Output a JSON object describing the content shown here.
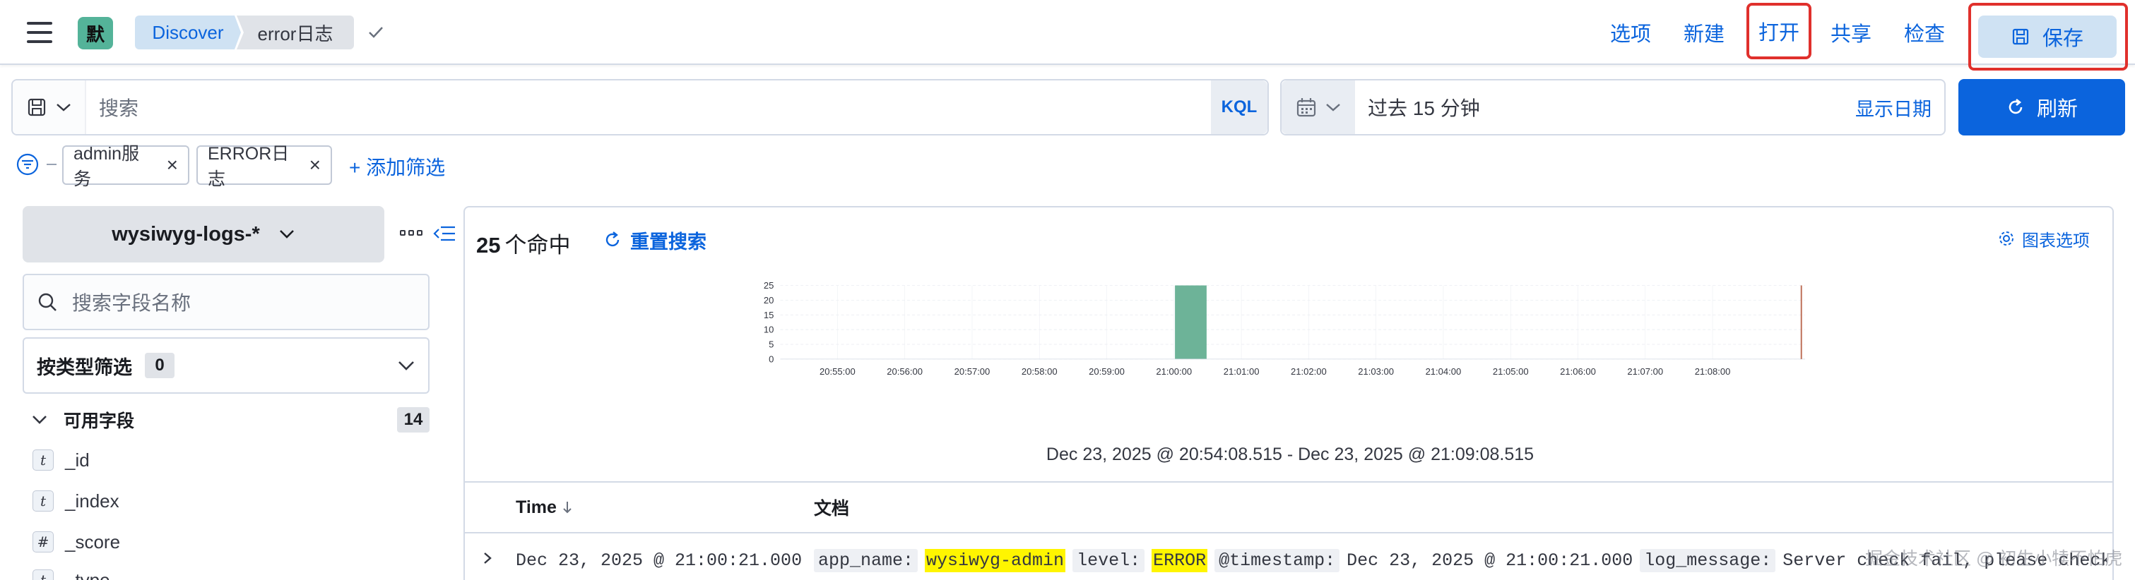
{
  "header": {
    "space_initial": "默",
    "breadcrumbs": [
      "Discover",
      "error日志"
    ],
    "nav": {
      "options": "选项",
      "new": "新建",
      "open": "打开",
      "share": "共享",
      "inspect": "检查",
      "save": "保存"
    },
    "highlight_color": "#e0302c",
    "accent_color": "#0b64dd"
  },
  "query": {
    "placeholder": "搜索",
    "language": "KQL",
    "time_range": "过去 15 分钟",
    "show_dates": "显示日期",
    "refresh": "刷新"
  },
  "filters": {
    "pills": [
      "admin服务",
      "ERROR日志"
    ],
    "add": "+ 添加筛选"
  },
  "sidebar": {
    "index_pattern": "wysiwyg-logs-*",
    "field_search_placeholder": "搜索字段名称",
    "type_filter": {
      "label": "按类型筛选",
      "count": "0"
    },
    "available": {
      "label": "可用字段",
      "count": "14"
    },
    "fields": [
      {
        "type": "t",
        "name": "_id"
      },
      {
        "type": "t",
        "name": "_index"
      },
      {
        "type": "#",
        "name": "_score"
      },
      {
        "type": "t",
        "name": "_type"
      }
    ]
  },
  "main": {
    "hit_count": "25",
    "hit_suffix": "个命中",
    "reset_search": "重置搜索",
    "chart_options": "图表选项",
    "time_range_label": "Dec 23, 2025 @ 20:54:08.515 - Dec 23, 2025 @ 21:09:08.515",
    "table": {
      "columns": [
        "Time",
        "文档"
      ],
      "rows": [
        {
          "time": "Dec 23, 2025 @ 21:00:21.000",
          "fields": [
            {
              "key": "app_name:",
              "value": "wysiwyg-admin",
              "highlight": true
            },
            {
              "key": "level:",
              "value": "ERROR",
              "highlight": true
            },
            {
              "key": "@timestamp:",
              "value": "Dec 23, 2025 @ 21:00:21.000",
              "highlight": false
            },
            {
              "key": "log_message:",
              "value": "Server check fail, please check",
              "highlight": false
            }
          ]
        }
      ]
    }
  },
  "chart_data": {
    "type": "bar",
    "categories": [
      "20:55:00",
      "20:56:00",
      "20:57:00",
      "20:58:00",
      "20:59:00",
      "21:00:00",
      "21:01:00",
      "21:02:00",
      "21:03:00",
      "21:04:00",
      "21:05:00",
      "21:06:00",
      "21:07:00",
      "21:08:00"
    ],
    "bars": [
      {
        "x": "21:00:00",
        "value": 25
      }
    ],
    "yticks": [
      0,
      5,
      10,
      15,
      20,
      25
    ],
    "ylim": [
      0,
      25
    ],
    "bar_color": "#6db398",
    "now_line_color": "#bd6e56",
    "grid": true
  },
  "watermark": "掘金技术社区 @ 初生小犊不怕虎"
}
